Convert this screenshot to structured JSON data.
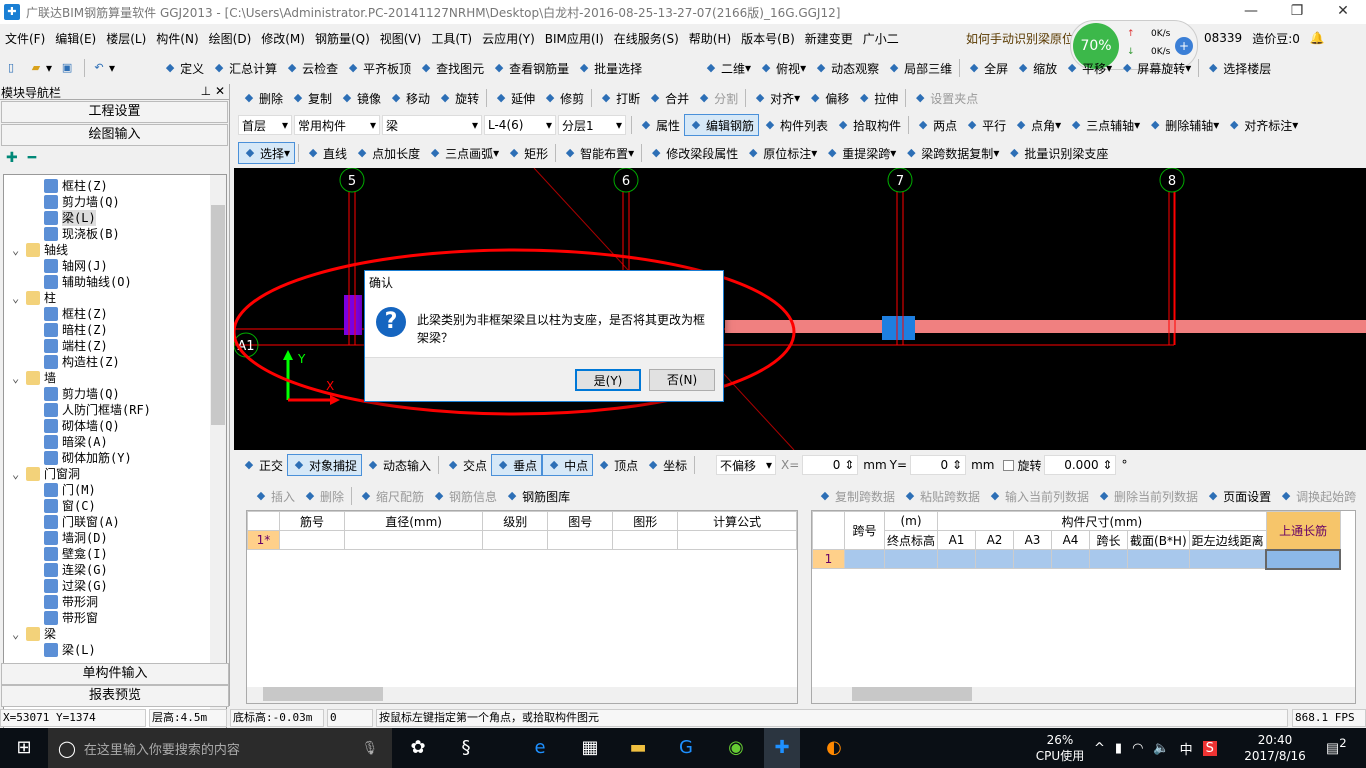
{
  "title": "广联达BIM钢筋算量软件 GGJ2013 - [C:\\Users\\Administrator.PC-20141127NRHM\\Desktop\\白龙村-2016-08-25-13-27-07(2166版)_16G.GGJ12]",
  "menu": [
    "文件(F)",
    "编辑(E)",
    "楼层(L)",
    "构件(N)",
    "绘图(D)",
    "修改(M)",
    "钢筋量(Q)",
    "视图(V)",
    "工具(T)",
    "云应用(Y)",
    "BIM应用(I)",
    "在线服务(S)",
    "帮助(H)",
    "版本号(B)",
    "新建变更",
    "广小二"
  ],
  "menu_right": {
    "question": "如何手动识别梁原位",
    "account": "08339",
    "price": "造价豆:0"
  },
  "float_widget": {
    "percent": "70%",
    "up": "0K/s",
    "down": "0K/s"
  },
  "toolbar1": [
    "定义",
    "汇总计算",
    "云检查",
    "平齐板顶",
    "查找图元",
    "查看钢筋量",
    "批量选择"
  ],
  "toolbar1_right": [
    "二维",
    "俯视",
    "动态观察",
    "局部三维",
    "全屏",
    "缩放",
    "平移",
    "屏幕旋转",
    "选择楼层"
  ],
  "toolbar2": [
    "删除",
    "复制",
    "镜像",
    "移动",
    "旋转",
    "延伸",
    "修剪",
    "打断",
    "合并",
    "分割",
    "对齐",
    "偏移",
    "拉伸",
    "设置夹点"
  ],
  "toolbar3": {
    "combos": [
      "首层",
      "常用构件",
      "梁",
      "L-4(6)",
      "分层1"
    ],
    "buttons": [
      "属性",
      "编辑钢筋",
      "构件列表",
      "拾取构件",
      "两点",
      "平行",
      "点角",
      "三点辅轴",
      "删除辅轴",
      "对齐标注"
    ]
  },
  "toolbar4": [
    "选择",
    "直线",
    "点加长度",
    "三点画弧",
    "矩形",
    "智能布置",
    "修改梁段属性",
    "原位标注",
    "重提梁跨",
    "梁跨数据复制",
    "批量识别梁支座"
  ],
  "nav": {
    "title": "模块导航栏",
    "top_buttons": [
      "工程设置",
      "绘图输入"
    ],
    "bottom_buttons": [
      "单构件输入",
      "报表预览"
    ],
    "tree": [
      {
        "label": "框柱(Z)",
        "level": 2,
        "icon": "column-icon"
      },
      {
        "label": "剪力墙(Q)",
        "level": 2,
        "icon": "shear-wall-icon"
      },
      {
        "label": "梁(L)",
        "level": 2,
        "icon": "beam-icon",
        "selected": true
      },
      {
        "label": "现浇板(B)",
        "level": 2,
        "icon": "slab-icon"
      },
      {
        "label": "轴线",
        "level": 1,
        "icon": "folder-icon"
      },
      {
        "label": "轴网(J)",
        "level": 2,
        "icon": "grid-icon"
      },
      {
        "label": "辅助轴线(O)",
        "level": 2,
        "icon": "aux-axis-icon"
      },
      {
        "label": "柱",
        "level": 1,
        "icon": "folder-icon"
      },
      {
        "label": "框柱(Z)",
        "level": 2,
        "icon": "column-icon"
      },
      {
        "label": "暗柱(Z)",
        "level": 2,
        "icon": "column-icon"
      },
      {
        "label": "端柱(Z)",
        "level": 2,
        "icon": "column-icon"
      },
      {
        "label": "构造柱(Z)",
        "level": 2,
        "icon": "column-icon"
      },
      {
        "label": "墙",
        "level": 1,
        "icon": "folder-icon"
      },
      {
        "label": "剪力墙(Q)",
        "level": 2,
        "icon": "shear-wall-icon"
      },
      {
        "label": "人防门框墙(RF)",
        "level": 2,
        "icon": "wall-icon"
      },
      {
        "label": "砌体墙(Q)",
        "level": 2,
        "icon": "brick-wall-icon"
      },
      {
        "label": "暗梁(A)",
        "level": 2,
        "icon": "beam-icon"
      },
      {
        "label": "砌体加筋(Y)",
        "level": 2,
        "icon": "rebar-icon"
      },
      {
        "label": "门窗洞",
        "level": 1,
        "icon": "folder-icon"
      },
      {
        "label": "门(M)",
        "level": 2,
        "icon": "door-icon"
      },
      {
        "label": "窗(C)",
        "level": 2,
        "icon": "window-icon"
      },
      {
        "label": "门联窗(A)",
        "level": 2,
        "icon": "door-window-icon"
      },
      {
        "label": "墙洞(D)",
        "level": 2,
        "icon": "wall-hole-icon"
      },
      {
        "label": "壁龛(I)",
        "level": 2,
        "icon": "niche-icon"
      },
      {
        "label": "连梁(G)",
        "level": 2,
        "icon": "link-beam-icon"
      },
      {
        "label": "过梁(G)",
        "level": 2,
        "icon": "lintel-icon"
      },
      {
        "label": "带形洞",
        "level": 2,
        "icon": "strip-hole-icon"
      },
      {
        "label": "带形窗",
        "level": 2,
        "icon": "strip-window-icon"
      },
      {
        "label": "梁",
        "level": 1,
        "icon": "folder-icon"
      },
      {
        "label": "梁(L)",
        "level": 2,
        "icon": "beam-icon"
      }
    ]
  },
  "canvas": {
    "axes": [
      "5",
      "6",
      "7",
      "8"
    ],
    "row_axis": "A1",
    "x_label": "X",
    "y_label": "Y"
  },
  "dialog": {
    "title": "确认",
    "message": "此梁类别为非框架梁且以柱为支座，是否将其更改为框架梁？",
    "yes": "是(Y)",
    "no": "否(N)"
  },
  "snapbar": {
    "items": [
      "正交",
      "对象捕捉",
      "动态输入",
      "交点",
      "垂点",
      "中点",
      "顶点",
      "坐标"
    ],
    "offset": "不偏移",
    "x_label": "X=",
    "x_value": "0",
    "y_label": "Y=",
    "y_value": "0",
    "unit": "mm",
    "rotate_label": "旋转",
    "rotate_value": "0.000",
    "degree": "°"
  },
  "rebar_panel": {
    "toolbar": [
      "插入",
      "删除",
      "缩尺配筋",
      "钢筋信息",
      "钢筋图库"
    ],
    "columns": [
      "筋号",
      "直径(mm)",
      "级别",
      "图号",
      "图形",
      "计算公式"
    ],
    "rows": [
      [
        "1*",
        "",
        "",
        "",
        "",
        "",
        ""
      ]
    ]
  },
  "span_panel": {
    "toolbar": [
      "复制跨数据",
      "粘贴跨数据",
      "输入当前列数据",
      "删除当前列数据",
      "页面设置",
      "调换起始跨"
    ],
    "col_span": "跨号",
    "col_elev_partial": "(m)",
    "col_end_elev": "终点标高",
    "group_size": "构件尺寸(mm)",
    "size_cols": [
      "A1",
      "A2",
      "A3",
      "A4",
      "跨长",
      "截面(B*H)",
      "距左边线距离"
    ],
    "col_top": "上通长筋",
    "rows": [
      [
        "1"
      ]
    ]
  },
  "status": {
    "coords": "X=53071 Y=1374",
    "floor_height": "层高:4.5m",
    "bottom_elev": "底标高:-0.03m",
    "value": "0",
    "hint": "按鼠标左键指定第一个角点，或拾取构件图元",
    "fps": "868.1 FPS"
  },
  "taskbar": {
    "search_placeholder": "在这里输入你要搜索的内容",
    "cpu_percent": "26%",
    "cpu_label": "CPU使用",
    "ime": "中",
    "time": "20:40",
    "date": "2017/8/16",
    "notifications": "2"
  },
  "colors": {
    "canvas_bg": "#000000",
    "axis_line": "#ff0000",
    "axis_bubble": "#00aa00",
    "beam": "#f08080",
    "column_purple": "#7b00e0",
    "column_blue": "#1e7fe0",
    "annotation_ellipse": "#ff0000",
    "accent": "#1a7fd4"
  }
}
